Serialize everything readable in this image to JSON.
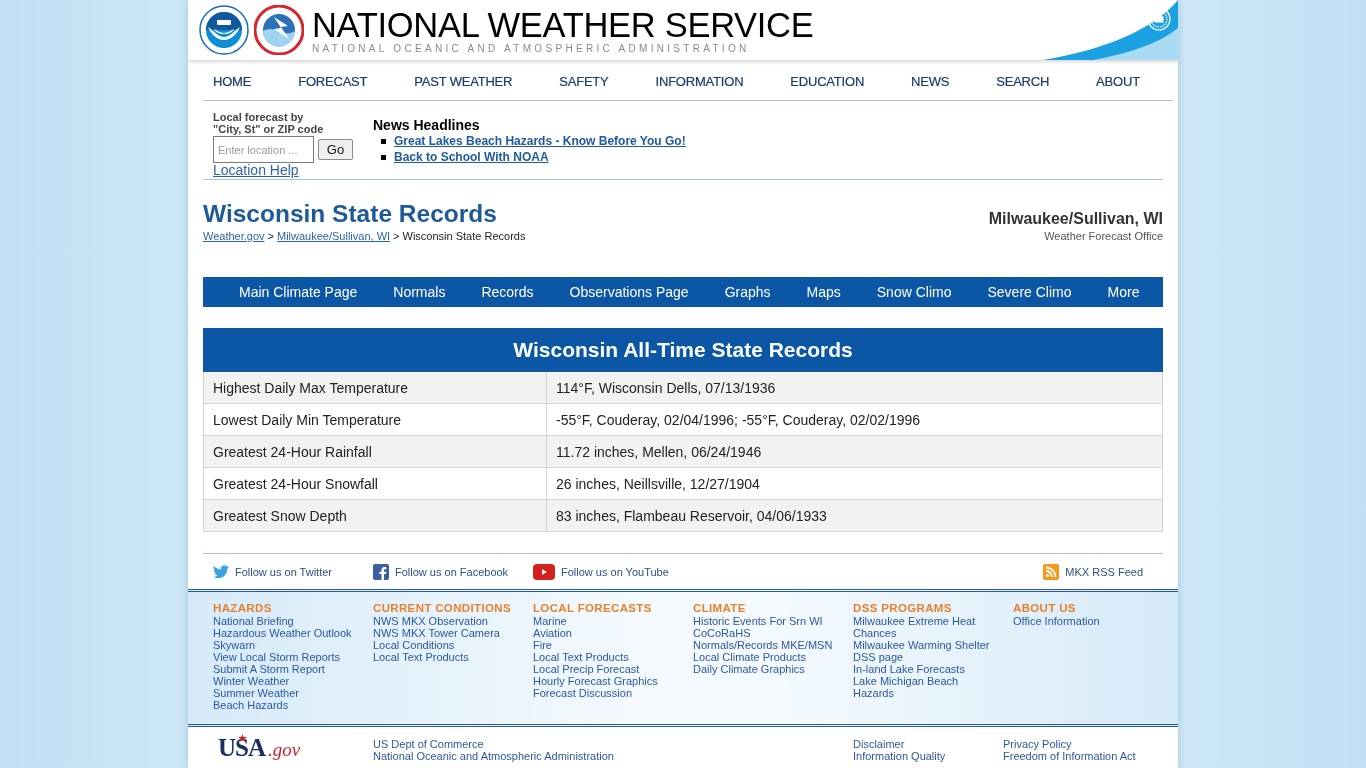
{
  "header": {
    "title": "NATIONAL WEATHER SERVICE",
    "subtitle": "NATIONAL OCEANIC AND ATMOSPHERIC ADMINISTRATION"
  },
  "nav": [
    "HOME",
    "FORECAST",
    "PAST WEATHER",
    "SAFETY",
    "INFORMATION",
    "EDUCATION",
    "NEWS",
    "SEARCH",
    "ABOUT"
  ],
  "location_search": {
    "label_lines": [
      "Local forecast by",
      "\"City, St\" or ZIP code"
    ],
    "placeholder": "Enter location ...",
    "button": "Go",
    "help_link": "Location Help"
  },
  "news": {
    "title": "News Headlines",
    "items": [
      "Great Lakes Beach Hazards - Know Before You Go!",
      "Back to School With NOAA"
    ]
  },
  "page_title": "Wisconsin State Records",
  "breadcrumb": [
    {
      "kind": "link",
      "text": "Weather.gov"
    },
    {
      "kind": "separator",
      "text": ">"
    },
    {
      "kind": "link",
      "text": "Milwaukee/Sullivan, WI"
    },
    {
      "kind": "separator",
      "text": ">"
    },
    {
      "kind": "current",
      "text": "Wisconsin State Records"
    }
  ],
  "office": {
    "name": "Milwaukee/Sullivan, WI",
    "type": "Weather Forecast Office"
  },
  "climate_menu": [
    "Main Climate Page",
    "Normals",
    "Records",
    "Observations Page",
    "Graphs",
    "Maps",
    "Snow Climo",
    "Severe Climo",
    "More"
  ],
  "records_table": {
    "title": "Wisconsin All-Time State Records",
    "rows": [
      {
        "record": "Highest Daily Max Temperature",
        "value": "114°F, Wisconsin Dells, 07/13/1936"
      },
      {
        "record": "Lowest Daily Min Temperature",
        "value": "-55°F, Couderay, 02/04/1996; -55°F, Couderay, 02/02/1996"
      },
      {
        "record": "Greatest 24-Hour Rainfall",
        "value": "11.72 inches, Mellen, 06/24/1946"
      },
      {
        "record": "Greatest 24-Hour Snowfall",
        "value": "26 inches, Neillsville, 12/27/1904"
      },
      {
        "record": "Greatest Snow Depth",
        "value": "83 inches, Flambeau Reservoir, 04/06/1933"
      }
    ]
  },
  "social_links": [
    {
      "kind": "twitter",
      "label": "Follow us on Twitter"
    },
    {
      "kind": "facebook",
      "label": "Follow us on Facebook"
    },
    {
      "kind": "youtube",
      "label": "Follow us on YouTube"
    },
    {
      "kind": "rss",
      "label": "MKX RSS Feed"
    }
  ],
  "footer_columns": [
    {
      "heading": "HAZARDS",
      "links": [
        "National Briefing",
        "Hazardous Weather Outlook",
        "Skywarn",
        "View Local Storm Reports",
        "Submit A Storm Report",
        "Winter Weather",
        "Summer Weather",
        "Beach Hazards"
      ]
    },
    {
      "heading": "CURRENT CONDITIONS",
      "links": [
        "NWS MKX Observation",
        "NWS MKX Tower Camera",
        "Local Conditions",
        "Local Text Products"
      ]
    },
    {
      "heading": "LOCAL FORECASTS",
      "links": [
        "Marine",
        "Aviation",
        "Fire",
        "Local Text Products",
        "Local Precip Forecast",
        "Hourly Forecast Graphics",
        "Forecast Discussion"
      ]
    },
    {
      "heading": "CLIMATE",
      "links": [
        "Historic Events For Srn WI",
        "CoCoRaHS",
        "Normals/Records MKE/MSN",
        "Local Climate Products",
        "Daily Climate Graphics"
      ]
    },
    {
      "heading": "DSS PROGRAMS",
      "links": [
        "Milwaukee Extreme Heat Chances",
        "Milwaukee Warming Shelter",
        "DSS page",
        "In-land Lake Forecasts",
        "Lake Michigan Beach Hazards"
      ]
    },
    {
      "heading": "ABOUT US",
      "links": [
        "Office Information"
      ]
    }
  ],
  "bottom_footer": {
    "logo": {
      "main": "USA",
      "suffix": ".gov"
    },
    "columns": [
      [
        "US Dept of Commerce",
        "National Oceanic and Atmospheric Administration"
      ],
      [
        "Disclaimer",
        "Information Quality"
      ],
      [
        "Privacy Policy",
        "Freedom of Information Act"
      ]
    ]
  }
}
